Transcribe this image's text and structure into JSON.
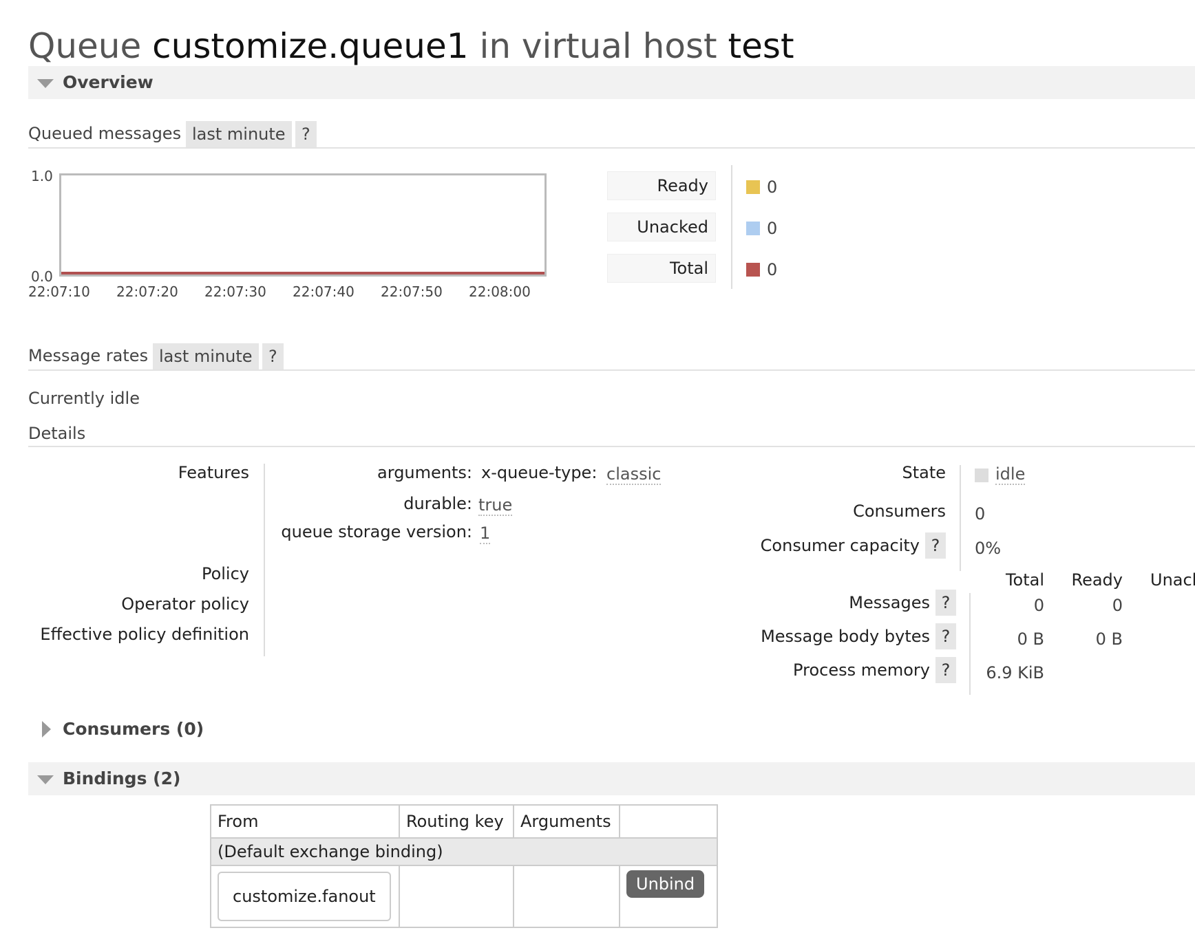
{
  "header": {
    "prefix": "Queue",
    "queue_name": "customize.queue1",
    "middle": "in virtual host",
    "vhost": "test"
  },
  "overview": {
    "section_label": "Overview",
    "queued_messages": {
      "label": "Queued messages",
      "range": "last minute",
      "help": "?",
      "chart_data": {
        "type": "line",
        "x": [
          "22:07:10",
          "22:07:20",
          "22:07:30",
          "22:07:40",
          "22:07:50",
          "22:08:00"
        ],
        "yticks": [
          "1.0",
          "0.0"
        ],
        "ylim": [
          0,
          1
        ],
        "series": [
          {
            "name": "Ready",
            "color": "#e8c453",
            "values": [
              0,
              0,
              0,
              0,
              0,
              0
            ]
          },
          {
            "name": "Unacked",
            "color": "#aecdf0",
            "values": [
              0,
              0,
              0,
              0,
              0,
              0
            ]
          },
          {
            "name": "Total",
            "color": "#b85450",
            "values": [
              0,
              0,
              0,
              0,
              0,
              0
            ]
          }
        ]
      },
      "legend": [
        {
          "label": "Ready",
          "value": "0",
          "color": "#e8c453"
        },
        {
          "label": "Unacked",
          "value": "0",
          "color": "#aecdf0"
        },
        {
          "label": "Total",
          "value": "0",
          "color": "#b85450"
        }
      ]
    },
    "message_rates": {
      "label": "Message rates",
      "range": "last minute",
      "help": "?",
      "status": "Currently idle"
    },
    "details": {
      "label": "Details",
      "features_label": "Features",
      "arguments_label": "arguments:",
      "arg_key": "x-queue-type:",
      "arg_value": "classic",
      "durable_label": "durable:",
      "durable_value": "true",
      "storage_label": "queue storage version:",
      "storage_value": "1",
      "policy_label": "Policy",
      "operator_policy_label": "Operator policy",
      "effective_policy_label": "Effective policy definition",
      "state_label": "State",
      "state_value": "idle",
      "consumers_label": "Consumers",
      "consumers_value": "0",
      "capacity_label": "Consumer capacity",
      "capacity_value": "0%",
      "help": "?",
      "stats_headers": [
        "Total",
        "Ready",
        "Unacl"
      ],
      "messages_label": "Messages",
      "messages_total": "0",
      "messages_ready": "0",
      "body_bytes_label": "Message body bytes",
      "body_bytes_total": "0 B",
      "body_bytes_ready": "0 B",
      "process_memory_label": "Process memory",
      "process_memory_total": "6.9 KiB"
    }
  },
  "consumers": {
    "label": "Consumers (0)"
  },
  "bindings": {
    "label": "Bindings (2)",
    "columns": [
      "From",
      "Routing key",
      "Arguments"
    ],
    "default_row": "(Default exchange binding)",
    "rows": [
      {
        "from": "customize.fanout",
        "routing_key": "",
        "arguments": "",
        "action": "Unbind"
      }
    ]
  }
}
